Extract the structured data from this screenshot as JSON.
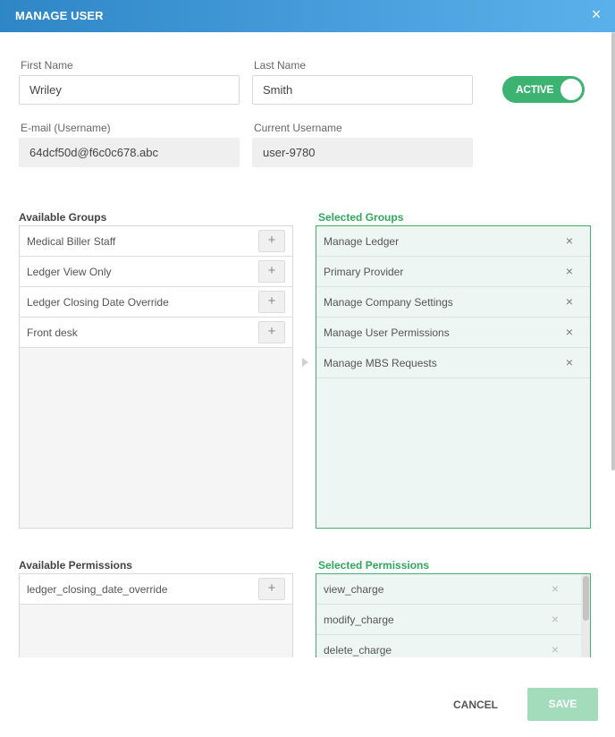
{
  "header": {
    "title": "MANAGE USER"
  },
  "form": {
    "first_name_label": "First Name",
    "first_name_value": "Wriley",
    "last_name_label": "Last Name",
    "last_name_value": "Smith",
    "email_label": "E-mail (Username)",
    "email_value": "64dcf50d@f6c0c678.abc",
    "username_label": "Current Username",
    "username_value": "user-9780",
    "status_label": "ACTIVE"
  },
  "groups": {
    "available_title": "Available Groups",
    "selected_title": "Selected Groups",
    "available": [
      "Medical Biller Staff",
      "Ledger View Only",
      "Ledger Closing Date Override",
      "Front desk"
    ],
    "selected": [
      "Manage Ledger",
      "Primary Provider",
      "Manage Company Settings",
      "Manage User Permissions",
      "Manage MBS Requests"
    ]
  },
  "permissions": {
    "available_title": "Available Permissions",
    "selected_title": "Selected Permissions",
    "available": [
      "ledger_closing_date_override"
    ],
    "selected": [
      "view_charge",
      "modify_charge",
      "delete_charge"
    ]
  },
  "footer": {
    "cancel_label": "CANCEL",
    "save_label": "SAVE"
  },
  "icons": {
    "add": "+",
    "remove": "×",
    "close": "×"
  },
  "colors": {
    "header": "#3a93d3",
    "accent_green": "#3cb371",
    "save_disabled": "#a3dcbb"
  }
}
